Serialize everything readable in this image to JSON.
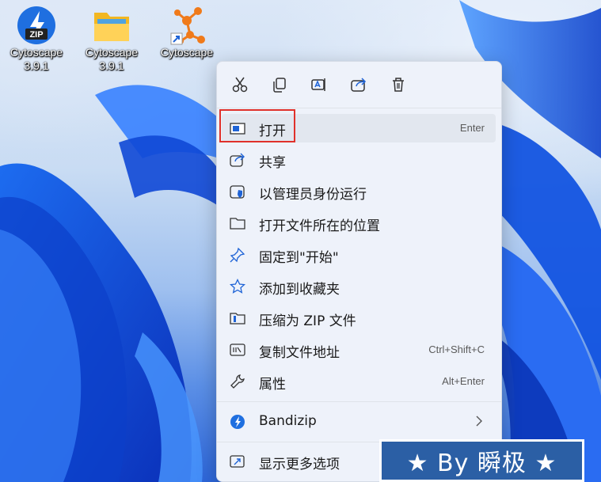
{
  "desktop": {
    "icons": [
      {
        "name": "Cytoscape",
        "line2": "3.9.1",
        "kind": "zip"
      },
      {
        "name": "Cytoscape",
        "line2": "3.9.1",
        "kind": "folder"
      },
      {
        "name": "Cytoscape",
        "line2": "",
        "kind": "shortcut"
      }
    ]
  },
  "context_menu": {
    "toolbar": [
      "cut",
      "copy",
      "rename",
      "share",
      "delete"
    ],
    "items": [
      {
        "label": "打开",
        "shortcut": "Enter",
        "icon": "open-icon"
      },
      {
        "label": "共享",
        "shortcut": "",
        "icon": "share-icon"
      },
      {
        "label": "以管理员身份运行",
        "shortcut": "",
        "icon": "admin-shield-icon"
      },
      {
        "label": "打开文件所在的位置",
        "shortcut": "",
        "icon": "folder-icon"
      },
      {
        "label": "固定到\"开始\"",
        "shortcut": "",
        "icon": "pin-icon"
      },
      {
        "label": "添加到收藏夹",
        "shortcut": "",
        "icon": "star-icon"
      },
      {
        "label": "压缩为 ZIP 文件",
        "shortcut": "",
        "icon": "zip-icon"
      },
      {
        "label": "复制文件地址",
        "shortcut": "Ctrl+Shift+C",
        "icon": "copy-path-icon"
      },
      {
        "label": "属性",
        "shortcut": "Alt+Enter",
        "icon": "wrench-icon"
      },
      {
        "label": "Bandizip",
        "shortcut": "",
        "icon": "bandizip-icon",
        "submenu": true
      },
      {
        "label": "显示更多选项",
        "shortcut": "",
        "icon": "more-options-icon"
      }
    ]
  },
  "watermark": "★ By 瞬极 ★",
  "colors": {
    "highlight_box": "#e0312b",
    "watermark_bg": "#2b5fa5",
    "accent": "#1e63d6"
  }
}
